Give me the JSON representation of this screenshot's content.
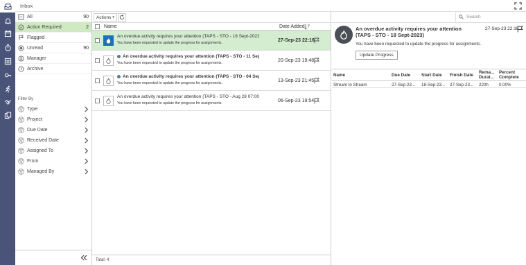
{
  "window": {
    "title": "Inbox"
  },
  "sidebar": {
    "items": [
      {
        "label": "All",
        "count": "90"
      },
      {
        "label": "Action Required",
        "count": "2"
      },
      {
        "label": "Flagged",
        "count": ""
      },
      {
        "label": "Unread",
        "count": "90"
      },
      {
        "label": "Manager",
        "count": ""
      },
      {
        "label": "Archive",
        "count": ""
      }
    ],
    "filter_heading": "Filter By",
    "filters": [
      {
        "label": "Type"
      },
      {
        "label": "Project"
      },
      {
        "label": "Due Date"
      },
      {
        "label": "Received Date"
      },
      {
        "label": "Assigned To"
      },
      {
        "label": "From"
      },
      {
        "label": "Managed By"
      }
    ]
  },
  "toolbar": {
    "actions_label": "Actions"
  },
  "list": {
    "columns": {
      "name": "Name",
      "date_added": "Date Added"
    },
    "rows": [
      {
        "subject": "An overdue activity requires your attention (TAPS - STO - 18 Sept-2023)",
        "body": "You have been requested to update the progress for assignments.",
        "date": "27-Sep-23 22:16"
      },
      {
        "subject": "An overdue activity requires your attention (TAPS - STO - 11 Sept 2...",
        "body": "You have been requested to update the progress for assignments.",
        "date": "20-Sep-23 19:48"
      },
      {
        "subject": "An overdue activity requires your attention (TAPS - STO - 04 Sept 2...",
        "body": "You have been requested to update the progress for assignments.",
        "date": "13-Sep-23 21:45"
      },
      {
        "subject": "An overdue activity requires your attention (TAPS - STO - Aug 28 07:00)",
        "body": "You have been requested to update the progress for assignments.",
        "date": "06-Sep-23 19:54"
      }
    ],
    "total": "Total: 4"
  },
  "search": {
    "placeholder": "Search"
  },
  "detail": {
    "title": "An overdue activity requires your attention (TAPS - STO - 18 Sept-2023)",
    "date": "27-Sep-23 22:16",
    "message": "You have been requested to update the progress for assignments.",
    "button": "Update Progress",
    "table": {
      "headers": [
        "Name",
        "Due Date",
        "Start Date",
        "Finish Date",
        "Rema... Durat...",
        "Percent Complete"
      ],
      "rows": [
        [
          "Stream to Stream",
          "27-Sep-23...",
          "18-Sep-23...",
          "27-Sep-23...",
          "220h",
          "0.00%"
        ]
      ]
    }
  },
  "colors": {
    "rail": "#4a5378",
    "selected": "#d4ecd0",
    "active_filter": "#cfe9c3",
    "accent": "#1e6fb5"
  }
}
